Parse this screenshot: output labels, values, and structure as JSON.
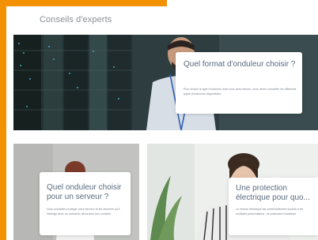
{
  "section": {
    "title": "Conseils d'experts"
  },
  "articles": [
    {
      "title": "Quel format d'onduleur choisir ?",
      "description": "Pour choisir le type d'onduleur dont vous avez besoin, vous devez connaître les différents types d'onduleurs disponibles."
    },
    {
      "title": "Quel onduleur choisir pour un serveur ?",
      "description": "Vous souhaitez protéger votre serveur et les données qu'il héberge avec un onduleur, découvrez nos conseils"
    },
    {
      "title": "Une protection électrique pour quo...",
      "description": "Le réseau électrique est continuellement soumis à de multiples perturbations : la surtension transitoire"
    }
  ],
  "colors": {
    "accent": "#f39200",
    "title_text": "#5a6a7e",
    "section_title": "#8a8f94"
  }
}
